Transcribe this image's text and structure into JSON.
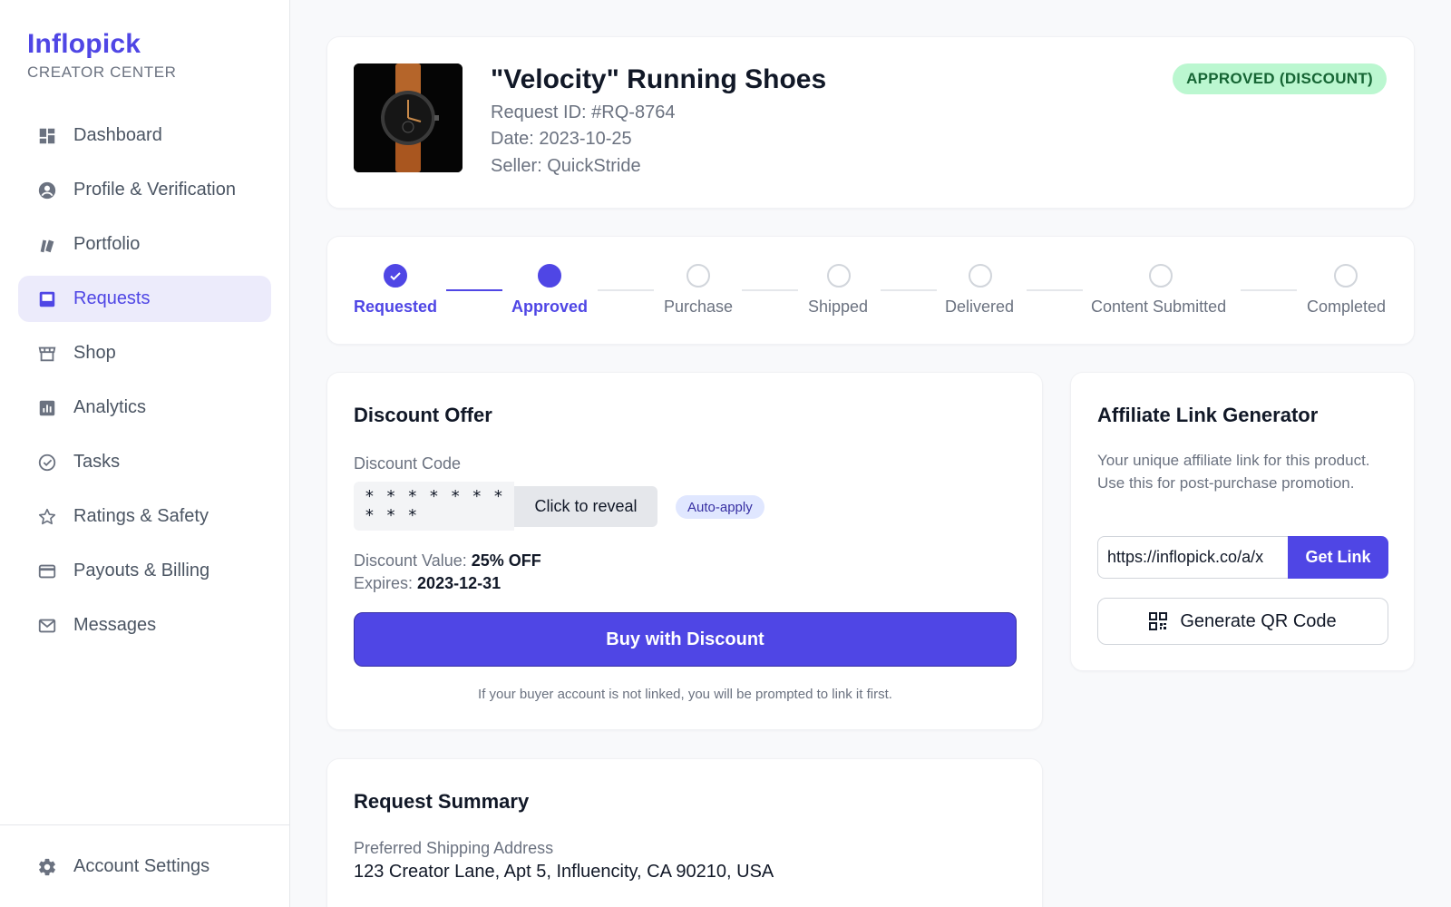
{
  "brand": {
    "name": "Inflopick",
    "subtitle": "CREATOR CENTER"
  },
  "sidebar": {
    "items": [
      {
        "label": "Dashboard",
        "icon": "dashboard-icon",
        "active": false
      },
      {
        "label": "Profile & Verification",
        "icon": "account-circle-icon",
        "active": false
      },
      {
        "label": "Portfolio",
        "icon": "collections-icon",
        "active": false
      },
      {
        "label": "Requests",
        "icon": "inbox-icon",
        "active": true
      },
      {
        "label": "Shop",
        "icon": "storefront-icon",
        "active": false
      },
      {
        "label": "Analytics",
        "icon": "bar-chart-icon",
        "active": false
      },
      {
        "label": "Tasks",
        "icon": "check-circle-icon",
        "active": false
      },
      {
        "label": "Ratings & Safety",
        "icon": "star-icon",
        "active": false
      },
      {
        "label": "Payouts & Billing",
        "icon": "credit-card-icon",
        "active": false
      },
      {
        "label": "Messages",
        "icon": "mail-icon",
        "active": false
      }
    ],
    "footer": {
      "label": "Account Settings",
      "icon": "gear-icon"
    }
  },
  "request": {
    "title": "\"Velocity\" Running Shoes",
    "id_text": "Request ID: #RQ-8764",
    "date_text": "Date: 2023-10-25",
    "seller_text": "Seller: QuickStride",
    "status": "APPROVED (DISCOUNT)",
    "thumbnail": "wristwatch-image"
  },
  "progress": {
    "steps": [
      {
        "label": "Requested",
        "state": "completed"
      },
      {
        "label": "Approved",
        "state": "current"
      },
      {
        "label": "Purchase",
        "state": "pending"
      },
      {
        "label": "Shipped",
        "state": "pending"
      },
      {
        "label": "Delivered",
        "state": "pending"
      },
      {
        "label": "Content Submitted",
        "state": "pending"
      },
      {
        "label": "Completed",
        "state": "pending"
      }
    ]
  },
  "discount": {
    "title": "Discount Offer",
    "code_label": "Discount Code",
    "code_masked": "* * * * * * * * * *",
    "reveal_label": "Click to reveal",
    "auto_apply": "Auto-apply",
    "value_label": "Discount Value:",
    "value": "25% OFF",
    "expires_label": "Expires:",
    "expires": "2023-12-31",
    "buy_label": "Buy with Discount",
    "note": "If your buyer account is not linked, you will be prompted to link it first."
  },
  "affiliate": {
    "title": "Affiliate Link Generator",
    "description": "Your unique affiliate link for this product. Use this for post-purchase promotion.",
    "link_value": "https://inflopick.co/a/x",
    "get_link_label": "Get Link",
    "qr_label": "Generate QR Code"
  },
  "summary": {
    "title": "Request Summary",
    "address_label": "Preferred Shipping Address",
    "address": "123 Creator Lane, Apt 5, Influencity, CA 90210, USA"
  },
  "colors": {
    "accent": "#4f46e5",
    "approved_bg": "#bbf7d0",
    "approved_text": "#166534"
  }
}
